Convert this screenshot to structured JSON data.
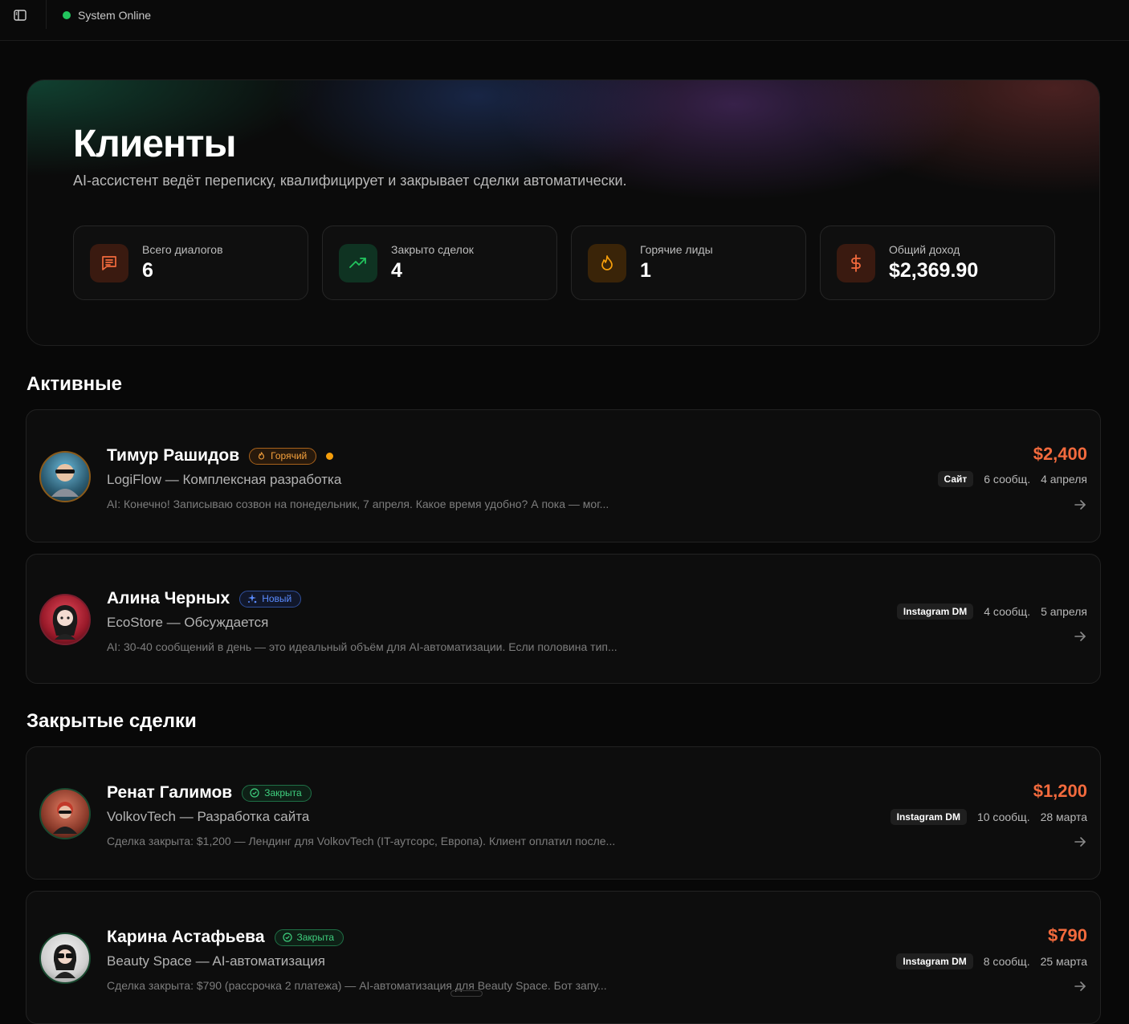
{
  "topbar": {
    "status": "System Online",
    "status_color": "#22c55e"
  },
  "hero": {
    "title": "Клиенты",
    "subtitle": "AI-ассистент ведёт переписку, квалифицирует и закрывает сделки автоматически."
  },
  "stats": [
    {
      "label": "Всего диалогов",
      "value": "6",
      "icon": "message-icon",
      "color": "#f26a3d"
    },
    {
      "label": "Закрыто сделок",
      "value": "4",
      "icon": "trending-up-icon",
      "color": "#22c55e"
    },
    {
      "label": "Горячие лиды",
      "value": "1",
      "icon": "flame-icon",
      "color": "#f59e0b"
    },
    {
      "label": "Общий доход",
      "value": "$2,369.90",
      "icon": "dollar-icon",
      "color": "#f26a3d"
    }
  ],
  "sections": {
    "active": "Активные",
    "closed": "Закрытые сделки"
  },
  "active_clients": [
    {
      "name": "Тимур Рашидов",
      "badge": "Горячий",
      "company": "LogiFlow — Комплексная разработка",
      "preview": "AI: Конечно! Записываю созвон на понедельник, 7 апреля. Какое время удобно? А пока — мог...",
      "price": "$2,400",
      "channel": "Сайт",
      "messages": "6 сообщ.",
      "date": "4 апреля"
    },
    {
      "name": "Алина Черных",
      "badge": "Новый",
      "company": "EcoStore — Обсуждается",
      "preview": "AI: 30-40 сообщений в день — это идеальный объём для AI-автоматизации. Если половина тип...",
      "channel": "Instagram DM",
      "messages": "4 сообщ.",
      "date": "5 апреля"
    }
  ],
  "closed_clients": [
    {
      "name": "Ренат Галимов",
      "badge": "Закрыта",
      "company": "VolkovTech — Разработка сайта",
      "preview": "Сделка закрыта: $1,200 — Лендинг для VolkovTech (IT-аутсорс, Европа). Клиент оплатил после...",
      "price": "$1,200",
      "channel": "Instagram DM",
      "messages": "10 сообщ.",
      "date": "28 марта"
    },
    {
      "name": "Карина Астафьева",
      "badge": "Закрыта",
      "company": "Beauty Space — AI-автоматизация",
      "preview": "Сделка закрыта: $790 (рассрочка 2 платежа) — AI-автоматизация для Beauty Space. Бот запу...",
      "price": "$790",
      "channel": "Instagram DM",
      "messages": "8 сообщ.",
      "date": "25 марта"
    }
  ],
  "colors": {
    "accent": "#f26a3d",
    "hot": "#f59e0b",
    "new": "#5b8cff",
    "closed": "#3fcf7e"
  }
}
